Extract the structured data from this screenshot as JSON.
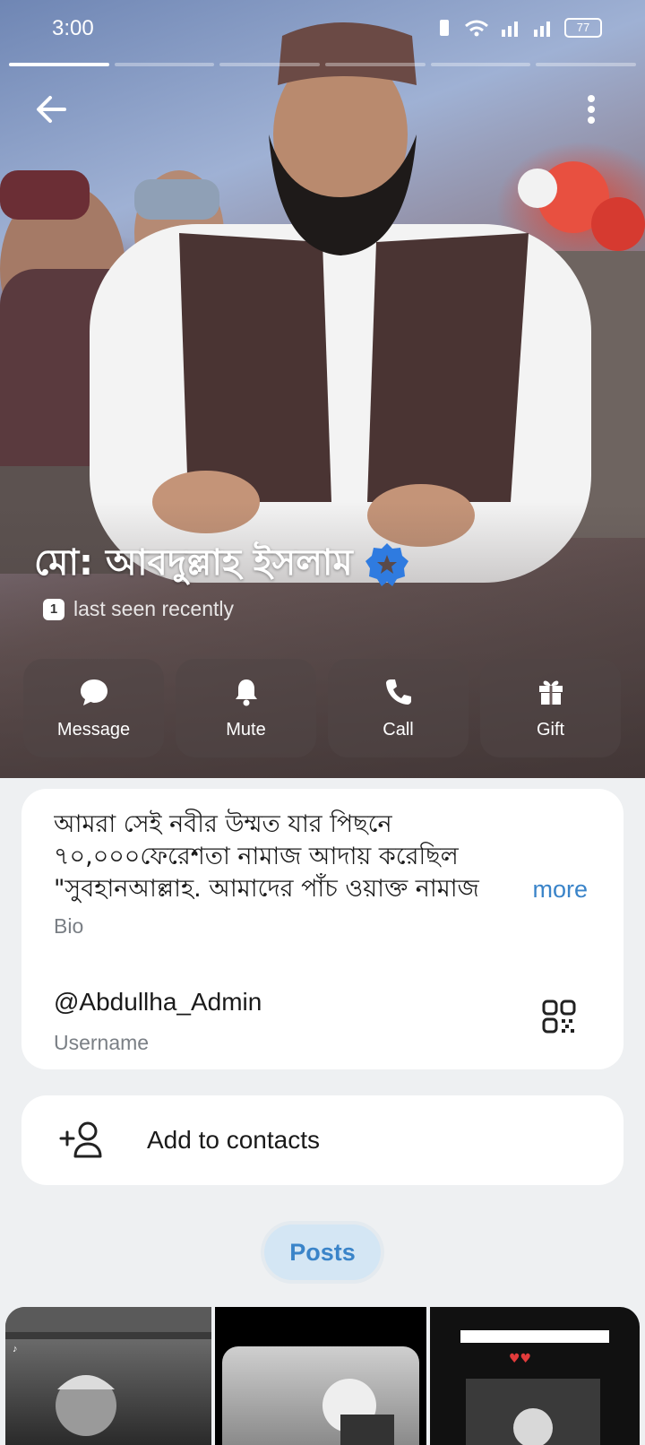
{
  "status_bar": {
    "time": "3:00",
    "battery": "77"
  },
  "profile": {
    "name": "মো: আবদুল্লাহ ইসলাম",
    "badge_count": "1",
    "last_seen": "last seen recently"
  },
  "actions": [
    {
      "label": "Message",
      "icon": "message-icon"
    },
    {
      "label": "Mute",
      "icon": "bell-icon"
    },
    {
      "label": "Call",
      "icon": "phone-icon"
    },
    {
      "label": "Gift",
      "icon": "gift-icon"
    }
  ],
  "info": {
    "bio_lines": [
      "আমরা সেই নবীর উম্মত যার পিছনে",
      "৭০,০০০ফেরেশতা নামাজ আদায় করেছিল",
      "\"সুবহানআল্লাহ. আমাদের পাঁচ ওয়াক্ত নামাজ"
    ],
    "more_label": "more",
    "bio_label": "Bio",
    "username": "@Abdullha_Admin",
    "username_label": "Username"
  },
  "add_contact": {
    "label": "Add to contacts"
  },
  "posts": {
    "tab_label": "Posts"
  },
  "colors": {
    "accent": "#3a84c9",
    "verified": "#2f7be0",
    "card": "#ffffff",
    "page_bg": "#eef0f2"
  }
}
